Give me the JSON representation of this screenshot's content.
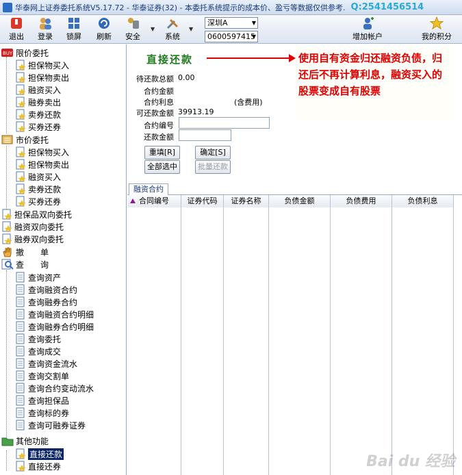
{
  "window": {
    "title": "华泰网上证券委托系统V5.17.72 - 华泰证券(32) - 本委托系统提示的成本价、盈亏等数据仅供参考.",
    "qq": "Q:2541456514"
  },
  "toolbar": {
    "exit": "退出",
    "login": "登录",
    "lock": "锁屏",
    "refresh": "刷新",
    "security": "安全",
    "system": "系统",
    "market_select": "深圳A",
    "account_select": "0600597415",
    "add_account": "增加帐户",
    "my_points": "我的积分"
  },
  "tree": {
    "limit_order": "限价委托",
    "limit_items": [
      "担保物买入",
      "担保物卖出",
      "融资买入",
      "融券卖出",
      "卖券还款",
      "买券还券"
    ],
    "market_order": "市价委托",
    "market_items": [
      "担保物买入",
      "担保物卖出",
      "融资买入",
      "卖券还款",
      "买券还券"
    ],
    "collateral_bidir": "担保品双向委托",
    "financing_bidir": "融资双向委托",
    "lending_bidir": "融券双向委托",
    "cancel": "撤　　单",
    "query": "查　　询",
    "query_items": [
      "查询资产",
      "查询融资合约",
      "查询融券合约",
      "查询融资合约明细",
      "查询融券合约明细",
      "查询委托",
      "查询成交",
      "查询资金流水",
      "查询交割单",
      "查询合约变动流水",
      "查询担保品",
      "查询标的券",
      "查询可融券证券"
    ],
    "other": "其他功能",
    "other_items": [
      "直接还款",
      "直接还券"
    ]
  },
  "form": {
    "heading": "直接还款",
    "note": "使用自有资金归还融资负债，归还后不再计算利息，融资买入的股票变成自有股票",
    "pending_total_label": "待还款总额",
    "pending_total_value": "0.00",
    "contract_amount_label": "合约金额",
    "contract_interest_label": "合约利息",
    "incl_fee": "(含费用)",
    "repayable_label": "可还款金额",
    "repayable_value": "39913.19",
    "contract_no_label": "合约编号",
    "repay_amount_label": "还款金额",
    "reset_btn": "重填[R]",
    "confirm_btn": "确定[S]",
    "select_all_btn": "全部选中",
    "batch_btn": "批量还款"
  },
  "grid": {
    "tab": "融资合约",
    "columns": [
      "合同编号",
      "证券代码",
      "证券名称",
      "负债金额",
      "负债费用",
      "负债利息"
    ]
  },
  "watermark": "Bai du 经验"
}
